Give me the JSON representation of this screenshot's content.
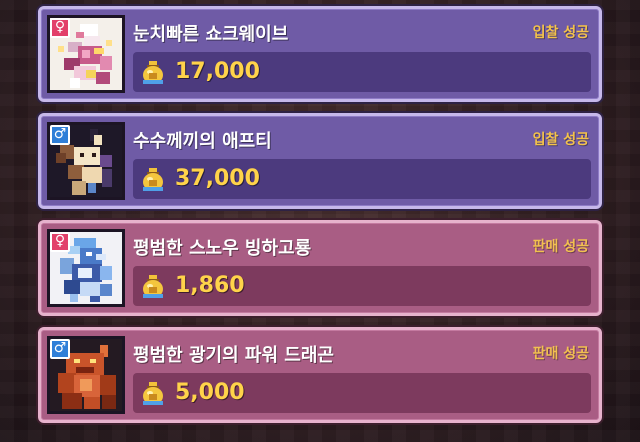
{
  "listings": [
    {
      "gender_symbol": "♀",
      "gender": "female",
      "name": "눈치빠른 쇼크웨이브",
      "status": "입찰 성공",
      "price": "17,000",
      "type": "buy",
      "portrait": "white-pink-dragon-icon"
    },
    {
      "gender_symbol": "♂",
      "gender": "male",
      "name": "수수께끼의 애프티",
      "status": "입찰 성공",
      "price": "37,000",
      "type": "buy",
      "portrait": "horned-cream-creature-icon"
    },
    {
      "gender_symbol": "♀",
      "gender": "female",
      "name": "평범한 스노우 빙하고룡",
      "status": "판매 성공",
      "price": "1,860",
      "type": "sell",
      "portrait": "snow-ice-dragon-icon"
    },
    {
      "gender_symbol": "♂",
      "gender": "male",
      "name": "평범한 광기의 파워 드래곤",
      "status": "판매 성공",
      "price": "5,000",
      "type": "sell",
      "portrait": "red-power-dragon-icon"
    }
  ],
  "colors": {
    "buy_card": "#6f5ba6",
    "sell_card": "#a95d84",
    "price_text": "#ffd34a",
    "status_text": "#f4c24a"
  }
}
